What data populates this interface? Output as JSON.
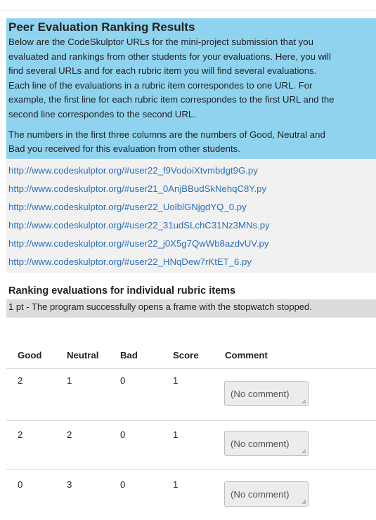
{
  "header": {
    "title": "Peer Evaluation Ranking Results",
    "desc1_lines": [
      "Below are the CodeSkulptor URLs for the mini-project submission that you",
      "evaluated and rankings from other students for your evaluations. Here, you will",
      "find several URLs and for each rubric item you will find several evaluations.",
      "Each line of the evaluations in a rubric item correspondes to one URL. For",
      "example, the first line for each rubric item correspondes to the first URL and the",
      "second line correspondes to the second URL."
    ],
    "desc2_lines": [
      "The numbers in the first three columns are the numbers of Good, Neutral and",
      "Bad you received for this evaluation from other students."
    ]
  },
  "urls": [
    "http://www.codeskulptor.org/#user22_f9VodoiXtvmbdgt9G.py",
    "http://www.codeskulptor.org/#user21_0AnjBBudSkNehqC8Y.py",
    "http://www.codeskulptor.org/#user22_UolblGNjgdYQ_0.py",
    "http://www.codeskulptor.org/#user22_31udSLchC31Nz3MNs.py",
    "http://www.codeskulptor.org/#user22_j0X5g7QwWb8azdvUV.py",
    "http://www.codeskulptor.org/#user22_HNqDew7rKtET_6.py"
  ],
  "ranking": {
    "title": "Ranking evaluations for individual rubric items",
    "rubric_item": "1 pt - The program successfully opens a frame with the stopwatch stopped.",
    "columns": [
      "Good",
      "Neutral",
      "Bad",
      "Score",
      "Comment"
    ],
    "rows": [
      {
        "good": "2",
        "neutral": "1",
        "bad": "0",
        "score": "1",
        "comment": "(No comment)"
      },
      {
        "good": "2",
        "neutral": "2",
        "bad": "0",
        "score": "1",
        "comment": "(No comment)"
      },
      {
        "good": "0",
        "neutral": "3",
        "bad": "0",
        "score": "1",
        "comment": "(No comment)"
      }
    ]
  },
  "colors": {
    "intro_bg": "#8fd3ef",
    "url_bg": "#f1f1f1",
    "link": "#2a6fb8",
    "rubric_bg": "#dcdcdc"
  }
}
